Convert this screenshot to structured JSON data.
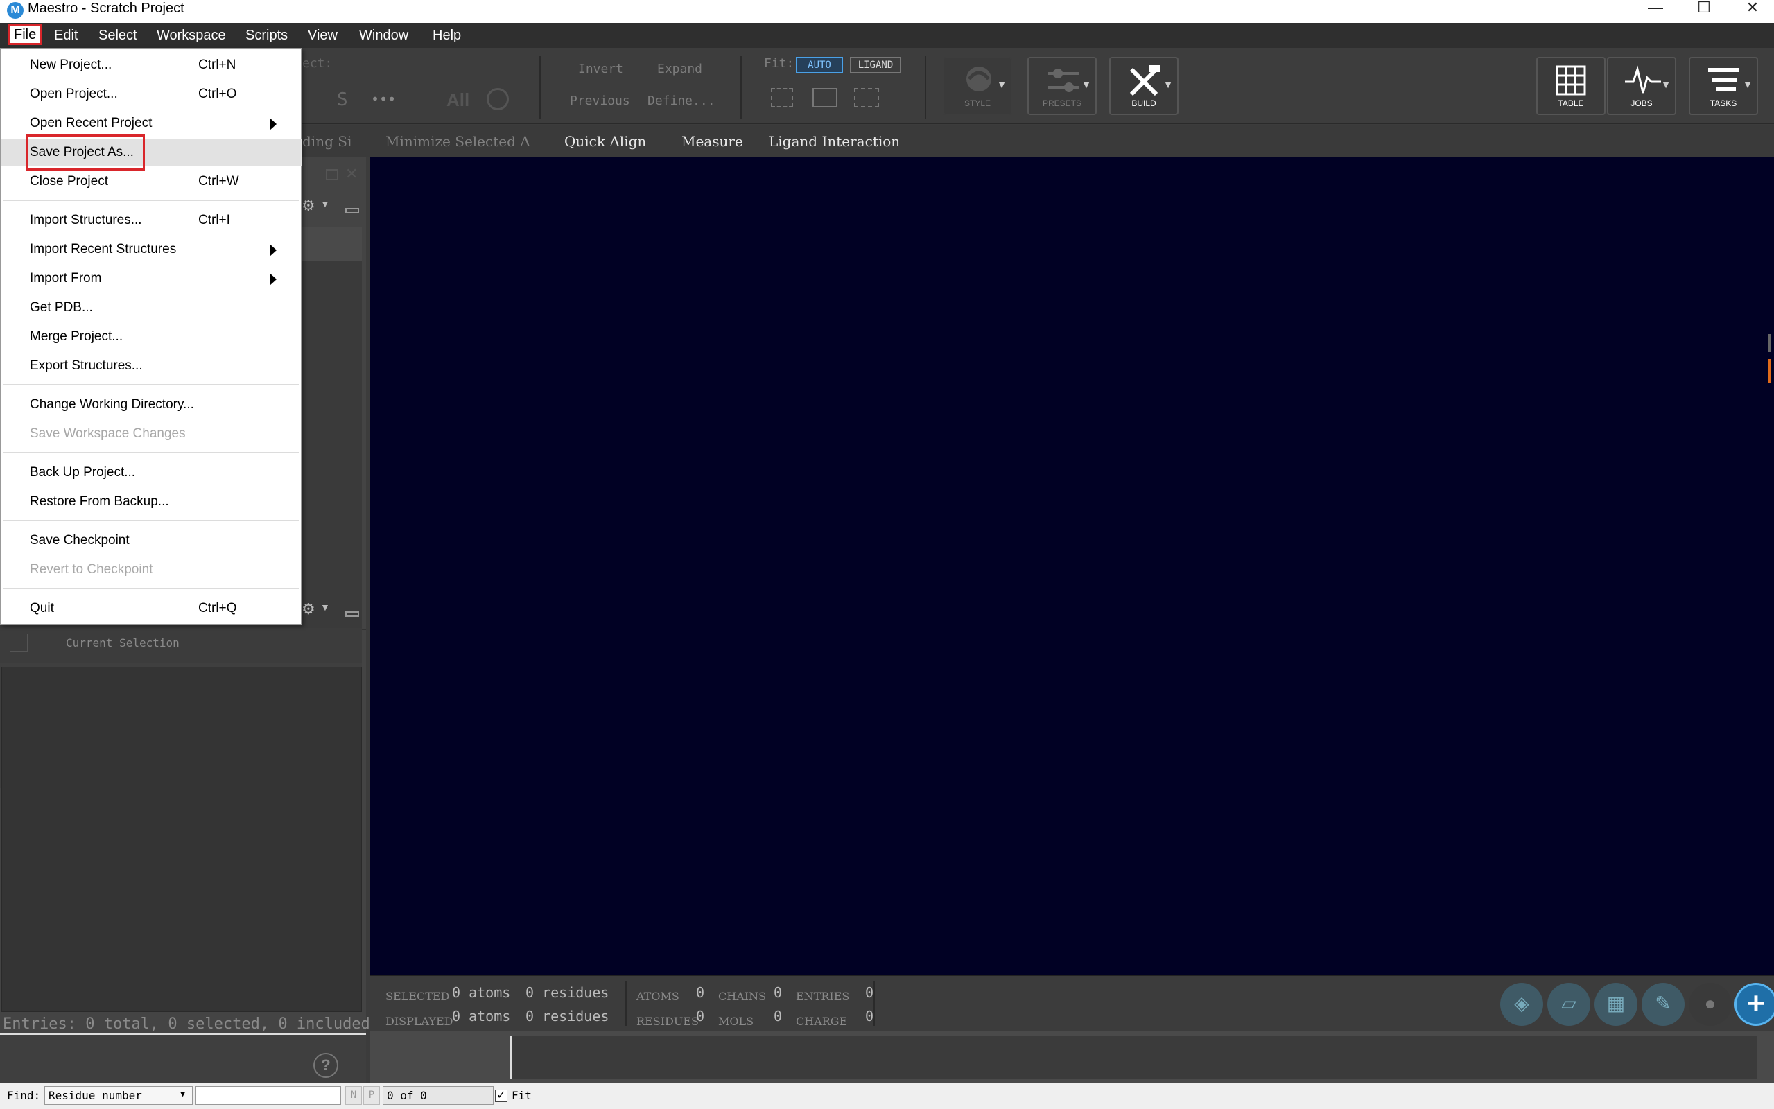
{
  "window": {
    "title": "Maestro - Scratch Project",
    "icon_letter": "M",
    "minimize": "—",
    "maximize": "☐",
    "close": "✕"
  },
  "menubar": [
    "File",
    "Edit",
    "Select",
    "Workspace",
    "Scripts",
    "View",
    "Window",
    "Help"
  ],
  "toolbar": {
    "select_label": "ect:",
    "s_button": "S",
    "more_button": "•••",
    "all_button": "All",
    "invert": "Invert",
    "expand": "Expand",
    "previous": "Previous",
    "define": "Define...",
    "fit_label": "Fit:",
    "fit_auto": "AUTO",
    "fit_ligand": "LIGAND",
    "style": "STYLE",
    "presets": "PRESETS",
    "build": "BUILD",
    "table": "TABLE",
    "jobs": "JOBS",
    "tasks": "TASKS"
  },
  "subtoolbar": {
    "partial": "ding Si",
    "minimize": "Minimize Selected A",
    "quick_align": "Quick Align",
    "measure": "Measure",
    "ligand_interaction": "Ligand Interaction"
  },
  "left_panel": {
    "current_selection": "Current Selection",
    "entries": "Entries: 0 total, 0 selected, 0 included"
  },
  "status": {
    "selected": "SELECTED",
    "displayed": "DISPLAYED",
    "selected_atoms": "0 atoms",
    "selected_residues": "0 residues",
    "displayed_atoms": "0 atoms",
    "displayed_residues": "0 residues",
    "atoms_lbl": "ATOMS",
    "atoms_val": "0",
    "residues_lbl": "RESIDUES",
    "residues_val": "0",
    "chains_lbl": "CHAINS",
    "chains_val": "0",
    "mols_lbl": "MOLS",
    "mols_val": "0",
    "entries_lbl": "ENTRIES",
    "entries_val": "0",
    "charge_lbl": "CHARGE",
    "charge_val": "0"
  },
  "findbar": {
    "find_label": "Find:",
    "find_type": "Residue number",
    "find_value": "",
    "n_button": "N",
    "p_button": "P",
    "count": "0 of 0",
    "fit_label": "Fit",
    "fit_checked": true
  },
  "file_menu": {
    "items": [
      {
        "label": "New Project...",
        "shortcut": "Ctrl+N"
      },
      {
        "label": "Open Project...",
        "shortcut": "Ctrl+O"
      },
      {
        "label": "Open Recent Project",
        "shortcut": ""
      },
      {
        "label": "Save Project As...",
        "shortcut": ""
      },
      {
        "label": "Close Project",
        "shortcut": "Ctrl+W"
      },
      {
        "label": "Import Structures...",
        "shortcut": "Ctrl+I"
      },
      {
        "label": "Import Recent Structures",
        "shortcut": ""
      },
      {
        "label": "Import From",
        "shortcut": ""
      },
      {
        "label": "Get PDB...",
        "shortcut": ""
      },
      {
        "label": "Merge Project...",
        "shortcut": ""
      },
      {
        "label": "Export Structures...",
        "shortcut": ""
      },
      {
        "label": "Change Working Directory...",
        "shortcut": ""
      },
      {
        "label": "Save Workspace Changes",
        "shortcut": ""
      },
      {
        "label": "Back Up Project...",
        "shortcut": ""
      },
      {
        "label": "Restore From Backup...",
        "shortcut": ""
      },
      {
        "label": "Save Checkpoint",
        "shortcut": ""
      },
      {
        "label": "Revert to Checkpoint",
        "shortcut": ""
      },
      {
        "label": "Quit",
        "shortcut": "Ctrl+Q"
      }
    ]
  },
  "colors": {
    "viewport": "#010124",
    "highlight_box": "#d9262b",
    "accent": "#4aa0e6"
  }
}
